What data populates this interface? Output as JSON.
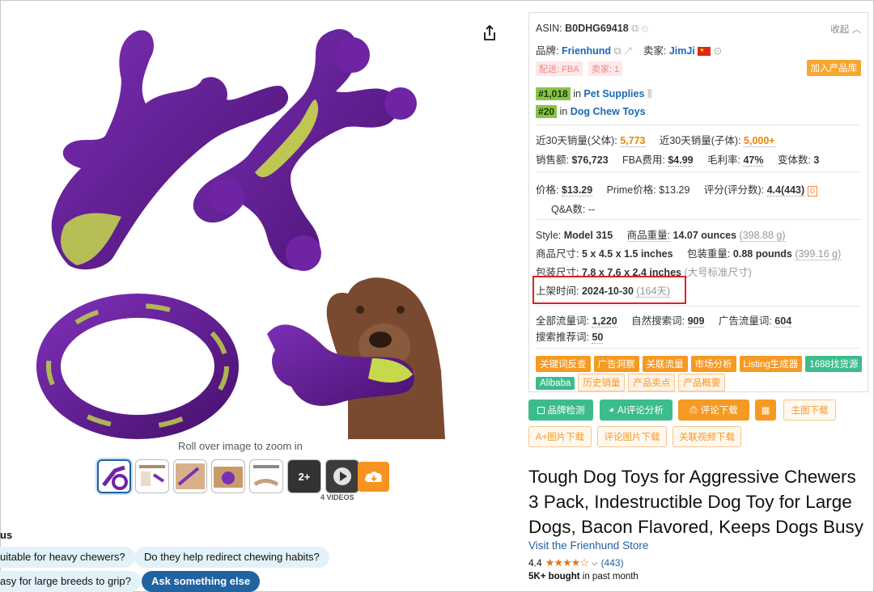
{
  "image_area": {
    "zoom_hint": "Roll over image to zoom in",
    "more_count": "2+",
    "videos_label": "4 VIDEOS"
  },
  "rufus": {
    "title": "us",
    "chips": [
      "uitable for heavy chewers?",
      "Do they help redirect chewing habits?",
      "asy for large breeds to grip?",
      "Ask something else"
    ]
  },
  "panel": {
    "asin_label": "ASIN:",
    "asin": "B0DHG69418",
    "collapse": "收起",
    "brand_label": "品牌:",
    "brand": "Frienhund",
    "seller_label": "卖家:",
    "seller": "JimJi",
    "tag_fba": "配送: FBA",
    "tag_sellers": "卖家: 1",
    "add_to_lib": "加入产品库",
    "rank1": "#1,018",
    "rank1_in": "in",
    "rank1_cat": "Pet Supplies",
    "rank2": "#20",
    "rank2_in": "in",
    "rank2_cat": "Dog Chew Toys",
    "sales30_parent_label": "近30天销量(父体):",
    "sales30_parent": "5,773",
    "sales30_child_label": "近30天销量(子体):",
    "sales30_child": "5,000+",
    "revenue_label": "销售额:",
    "revenue": "$76,723",
    "fba_fee_label": "FBA费用:",
    "fba_fee": "$4.99",
    "margin_label": "毛利率:",
    "margin": "47%",
    "variants_label": "变体数:",
    "variants": "3",
    "price_label": "价格:",
    "price": "$13.29",
    "prime_label": "Prime价格:",
    "prime_price": "$13.29",
    "rating_label": "评分(评分数):",
    "rating": "4.4(443)",
    "qa_label": "Q&A数:",
    "qa": "--",
    "style_label": "Style:",
    "style": "Model 315",
    "weight_label": "商品重量:",
    "weight": "14.07 ounces",
    "weight_g": "(398.88 g)",
    "dims_label": "商品尺寸:",
    "dims": "5 x 4.5 x 1.5 inches",
    "pkg_weight_label": "包装重量:",
    "pkg_weight": "0.88 pounds",
    "pkg_weight_g": "(399.16 g)",
    "pkg_dims_label": "包装尺寸:",
    "pkg_dims": "7.8 x 7.6 x 2.4 inches",
    "pkg_dims_note": "(大号标准尺寸)",
    "listed_label": "上架时间:",
    "listed": "2024-10-30",
    "listed_days": "(164天)",
    "traffic_all_label": "全部流量词:",
    "traffic_all": "1,220",
    "traffic_org_label": "自然搜索词:",
    "traffic_org": "909",
    "traffic_ad_label": "广告流量词:",
    "traffic_ad": "604",
    "search_rec_label": "搜索推荐词:",
    "search_rec": "50",
    "tool_tags": [
      "关键词反查",
      "广告洞察",
      "关联流量",
      "市场分析",
      "Listing生成器",
      "1688找货源"
    ],
    "tool_tags2": [
      "Alibaba",
      "历史销量",
      "产品卖点",
      "产品概要"
    ]
  },
  "actions": {
    "brand_check": "品牌检测",
    "ai_review": "AI评论分析",
    "review_download": "评论下载",
    "main_image_download": "主图下载",
    "aplus_download": "A+图片下载",
    "review_img_download": "评论图片下载",
    "video_download": "关联视频下载"
  },
  "product": {
    "title": "Tough Dog Toys for Aggressive Chewers 3 Pack, Indestructible Dog Toy for Large Dogs, Bacon Flavored, Keeps Dogs Busy",
    "store": "Visit the Frienhund Store",
    "rating": "4.4",
    "stars": "★★★★☆",
    "review_count": "(443)",
    "bought_bold": "5K+ bought",
    "bought_rest": "in past month"
  },
  "colors": {
    "purple": "#5b1a8c",
    "lime": "#c6d94a",
    "accent_orange": "#f59a23",
    "accent_green": "#3cbc8d",
    "link_blue": "#1a69b8"
  }
}
